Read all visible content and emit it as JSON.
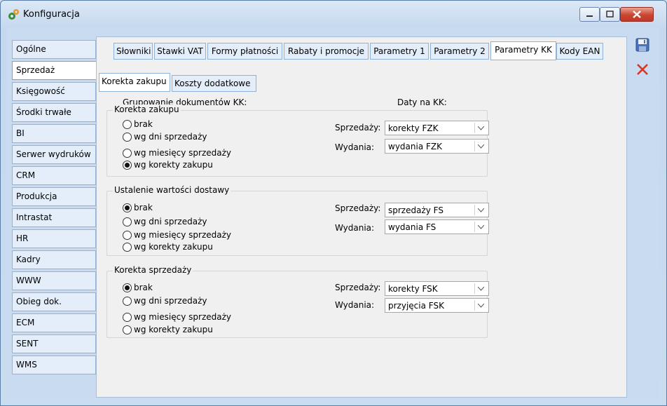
{
  "window": {
    "title": "Konfiguracja"
  },
  "sidebar": {
    "items": [
      {
        "label": "Ogólne"
      },
      {
        "label": "Sprzedaż"
      },
      {
        "label": "Księgowość"
      },
      {
        "label": "Środki trwałe"
      },
      {
        "label": "BI"
      },
      {
        "label": "Serwer wydruków"
      },
      {
        "label": "CRM"
      },
      {
        "label": "Produkcja"
      },
      {
        "label": "Intrastat"
      },
      {
        "label": "HR"
      },
      {
        "label": "Kadry"
      },
      {
        "label": "WWW"
      },
      {
        "label": "Obieg dok."
      },
      {
        "label": "ECM"
      },
      {
        "label": "SENT"
      },
      {
        "label": "WMS"
      }
    ],
    "active": "Sprzedaż"
  },
  "tabs": [
    {
      "label": "Słowniki"
    },
    {
      "label": "Stawki VAT"
    },
    {
      "label": "Formy płatności"
    },
    {
      "label": "Rabaty i promocje"
    },
    {
      "label": "Parametry 1"
    },
    {
      "label": "Parametry 2"
    },
    {
      "label": "Parametry KK"
    },
    {
      "label": "Kody EAN"
    }
  ],
  "active_tab": "Parametry KK",
  "subtabs": [
    {
      "label": "Korekta zakupu"
    },
    {
      "label": "Koszty dodatkowe"
    }
  ],
  "active_subtab": "Korekta zakupu",
  "headers": {
    "grouping": "Grupowanie dokumentów KK:",
    "dates": "Daty na KK:"
  },
  "groups": [
    {
      "title": "Korekta zakupu",
      "options": [
        "brak",
        "wg dni sprzedaży",
        "wg miesięcy sprzedaży",
        "wg korekty zakupu"
      ],
      "selected": "wg korekty zakupu",
      "sales_label": "Sprzedaży:",
      "sales_value": "korekty FZK",
      "issue_label": "Wydania:",
      "issue_value": "wydania FZK"
    },
    {
      "title": "Ustalenie wartości dostawy",
      "options": [
        "brak",
        "wg dni sprzedaży",
        "wg miesięcy sprzedaży",
        "wg korekty zakupu"
      ],
      "selected": "brak",
      "sales_label": "Sprzedaży:",
      "sales_value": "sprzedaży FS",
      "issue_label": "Wydania:",
      "issue_value": "wydania FS"
    },
    {
      "title": "Korekta sprzedaży",
      "options": [
        "brak",
        "wg dni sprzedaży",
        "wg miesięcy sprzedaży",
        "wg korekty zakupu"
      ],
      "selected": "brak",
      "sales_label": "Sprzedaży:",
      "sales_value": "korekty FSK",
      "issue_label": "Wydania:",
      "issue_value": "przyjęcia FSK"
    }
  ],
  "toolbar": {
    "save_icon": "save-icon",
    "close_icon": "close-icon"
  },
  "colors": {
    "accent": "#8fb2d9",
    "close_red": "#d9351f"
  }
}
